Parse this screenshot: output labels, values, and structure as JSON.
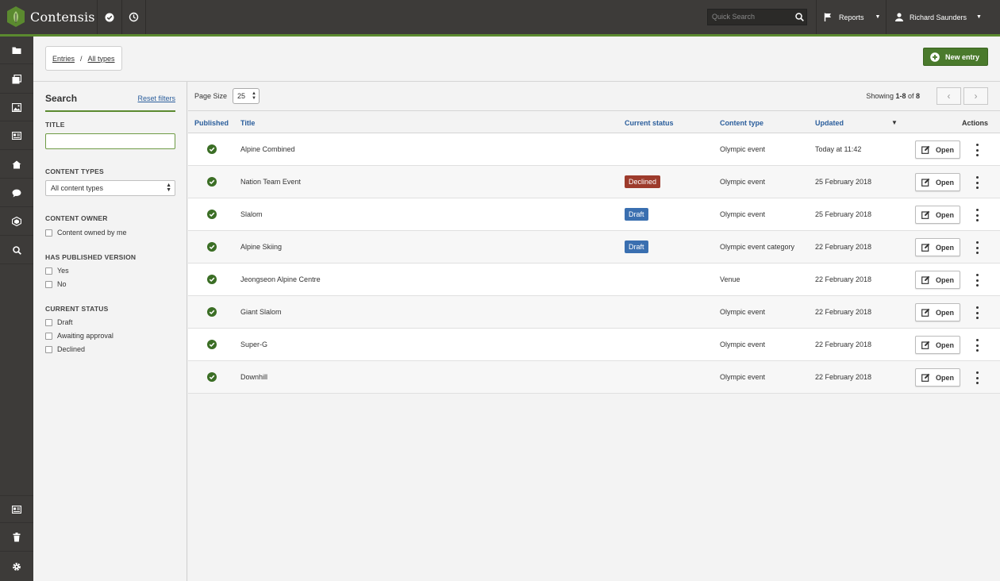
{
  "app": {
    "name": "Contensis"
  },
  "topbar": {
    "search_placeholder": "Quick Search",
    "reports_label": "Reports",
    "user_name": "Richard Saunders"
  },
  "breadcrumb": {
    "entries": "Entries",
    "sep": "/",
    "all_types": "All types"
  },
  "new_entry_label": "New entry",
  "filters": {
    "title": "Search",
    "reset": "Reset filters",
    "title_label": "TITLE",
    "content_types_label": "CONTENT TYPES",
    "content_types_value": "All content types",
    "content_owner_label": "CONTENT OWNER",
    "owned_by_me": "Content owned by me",
    "published_label": "HAS PUBLISHED VERSION",
    "yes": "Yes",
    "no": "No",
    "status_label": "CURRENT STATUS",
    "status_options": [
      "Draft",
      "Awaiting approval",
      "Declined"
    ]
  },
  "toolbar": {
    "page_size_label": "Page Size",
    "page_size_value": "25",
    "showing_prefix": "Showing ",
    "showing_range": "1-8",
    "showing_of": " of ",
    "showing_total": "8"
  },
  "columns": {
    "published": "Published",
    "title": "Title",
    "status": "Current status",
    "content_type": "Content type",
    "updated": "Updated",
    "sort_indicator": "▼",
    "actions": "Actions"
  },
  "open_label": "Open",
  "rows": [
    {
      "title": "Alpine Combined",
      "status": "",
      "content_type": "Olympic event",
      "updated": "Today at 11:42"
    },
    {
      "title": "Nation Team Event",
      "status": "Declined",
      "content_type": "Olympic event",
      "updated": "25 February 2018"
    },
    {
      "title": "Slalom",
      "status": "Draft",
      "content_type": "Olympic event",
      "updated": "25 February 2018"
    },
    {
      "title": "Alpine Skiing",
      "status": "Draft",
      "content_type": "Olympic event category",
      "updated": "22 February 2018"
    },
    {
      "title": "Jeongseon Alpine Centre",
      "status": "",
      "content_type": "Venue",
      "updated": "22 February 2018"
    },
    {
      "title": "Giant Slalom",
      "status": "",
      "content_type": "Olympic event",
      "updated": "22 February 2018"
    },
    {
      "title": "Super-G",
      "status": "",
      "content_type": "Olympic event",
      "updated": "22 February 2018"
    },
    {
      "title": "Downhill",
      "status": "",
      "content_type": "Olympic event",
      "updated": "22 February 2018"
    }
  ],
  "colors": {
    "accent_green": "#5b8a2f",
    "link_blue": "#2b5e9c",
    "draft_blue": "#3a6fb0",
    "declined_red": "#9d3b2c",
    "chrome": "#3d3b39"
  },
  "sidenav_icons": [
    "folder-icon",
    "entries-icon",
    "image-icon",
    "forms-icon",
    "home-icon",
    "comment-icon",
    "layers-icon",
    "search-icon",
    "content-icon",
    "trash-icon",
    "gear-icon"
  ]
}
